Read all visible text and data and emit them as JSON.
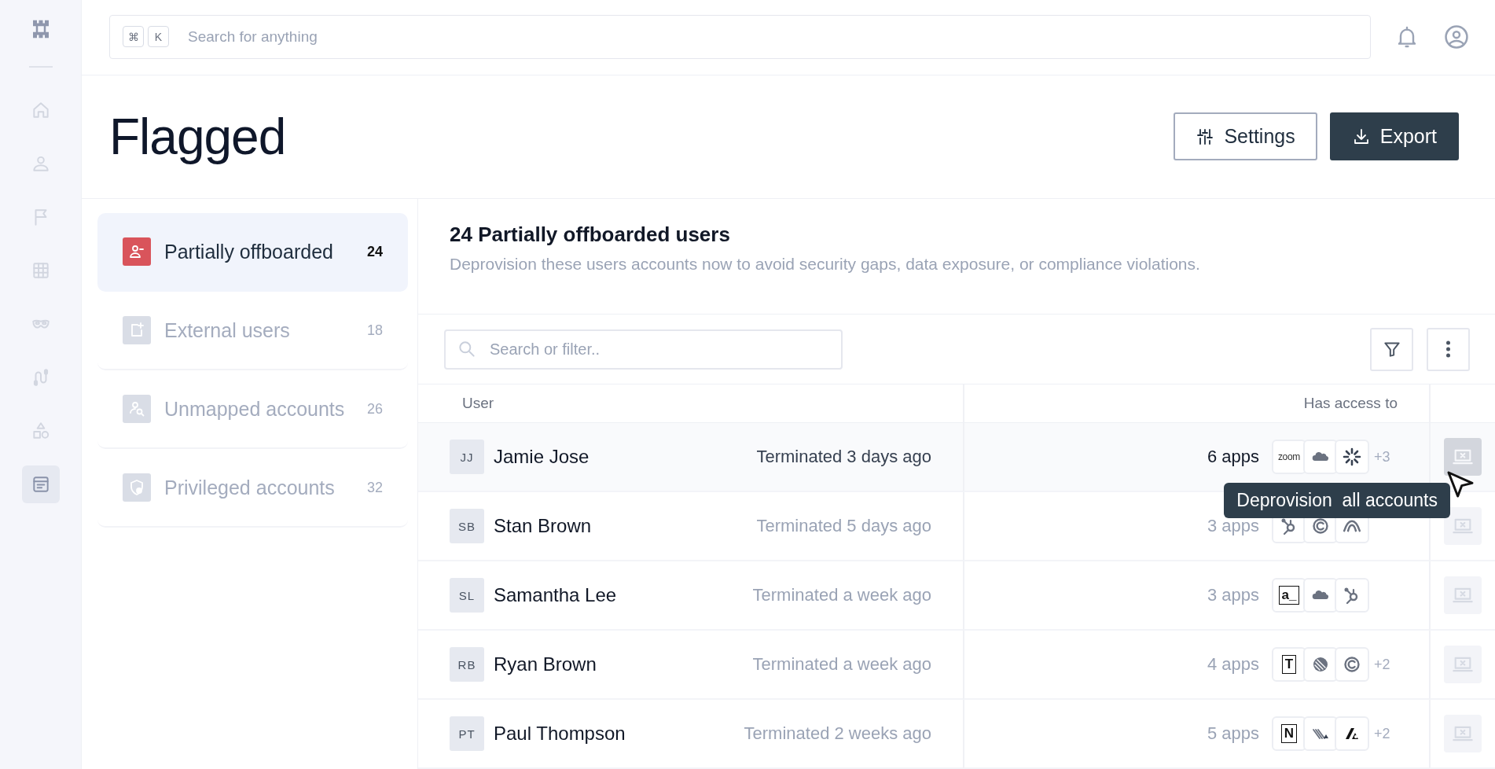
{
  "rail": {
    "items": [
      {
        "selected": false
      },
      {
        "selected": false
      },
      {
        "selected": false
      },
      {
        "selected": false
      },
      {
        "selected": false
      },
      {
        "selected": false
      },
      {
        "selected": false
      },
      {
        "selected": true
      }
    ]
  },
  "search": {
    "keys": [
      "⌘",
      "K"
    ],
    "placeholder": "Search for anything"
  },
  "page": {
    "title": "Flagged",
    "buttons": [
      {
        "label": "Settings",
        "kind": "outline"
      },
      {
        "label": "Export",
        "kind": "primary"
      }
    ]
  },
  "categories": [
    {
      "label": "Partially offboarded",
      "count": "24",
      "selected": true
    },
    {
      "label": "External users",
      "count": "18",
      "selected": false
    },
    {
      "label": "Unmapped accounts",
      "count": "26",
      "selected": false
    },
    {
      "label": "Privileged accounts",
      "count": "32",
      "selected": false
    }
  ],
  "panel": {
    "title": "24 Partially offboarded users",
    "subtitle": "Deprovision these users accounts now to avoid security gaps, data exposure, or compliance violations."
  },
  "filter": {
    "placeholder": "Search or filter.."
  },
  "table": {
    "columns": [
      "User",
      "Has access to"
    ],
    "rows": [
      {
        "initials": "JJ",
        "name": "Jamie Jose",
        "status": "Terminated 3 days ago",
        "apps_count": "6 apps",
        "apps": [
          {
            "kind": "wordmark",
            "text": "zoom"
          },
          {
            "kind": "cloud"
          },
          {
            "kind": "burst"
          }
        ],
        "more": "+3",
        "highlighted": true
      },
      {
        "initials": "SB",
        "name": "Stan Brown",
        "status": "Terminated 5 days ago",
        "apps_count": "3 apps",
        "apps": [
          {
            "kind": "hub"
          },
          {
            "kind": "ring"
          },
          {
            "kind": "arcs"
          }
        ],
        "highlighted": false
      },
      {
        "initials": "SL",
        "name": "Samantha Lee",
        "status": "Terminated a week ago",
        "apps_count": "3 apps",
        "apps": [
          {
            "kind": "letter",
            "text": "a_"
          },
          {
            "kind": "cloud"
          },
          {
            "kind": "hub"
          }
        ],
        "highlighted": false
      },
      {
        "initials": "RB",
        "name": "Ryan Brown",
        "status": "Terminated a week ago",
        "apps_count": "4 apps",
        "apps": [
          {
            "kind": "letter",
            "text": "T"
          },
          {
            "kind": "ball"
          },
          {
            "kind": "ring"
          }
        ],
        "more": "+2",
        "highlighted": false
      },
      {
        "initials": "PT",
        "name": "Paul Thompson",
        "status": "Terminated 2 weeks ago",
        "apps_count": "5 apps",
        "apps": [
          {
            "kind": "letter",
            "text": "N"
          },
          {
            "kind": "stairs"
          },
          {
            "kind": "blade"
          }
        ],
        "more": "+2",
        "highlighted": false
      }
    ]
  },
  "tooltip": {
    "text": "Deprovision  all accounts"
  }
}
